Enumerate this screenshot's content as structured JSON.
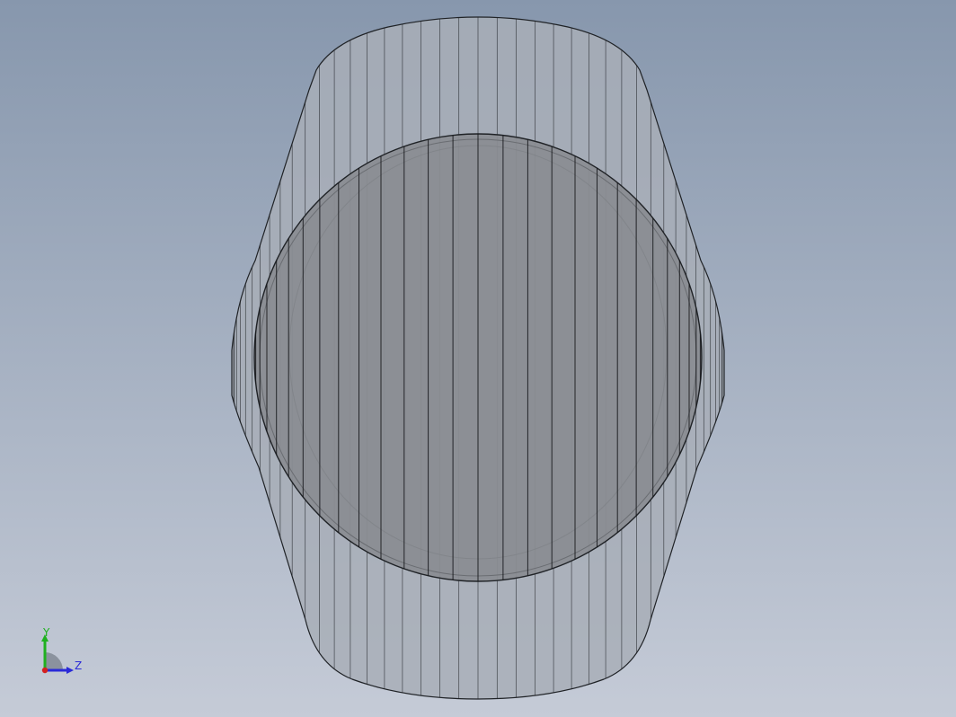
{
  "viewport": {
    "background_top": "#8797ad",
    "background_bottom": "#c5cbd7"
  },
  "model": {
    "outer_fill": "#a8aeb7",
    "inner_fill": "#8a8d92",
    "edge_color": "#1f2226"
  },
  "triad": {
    "y_label": "Y",
    "z_label": "Z",
    "y_color": "#1fb01f",
    "z_color": "#2a2ad8",
    "x_color": "#d42020"
  }
}
